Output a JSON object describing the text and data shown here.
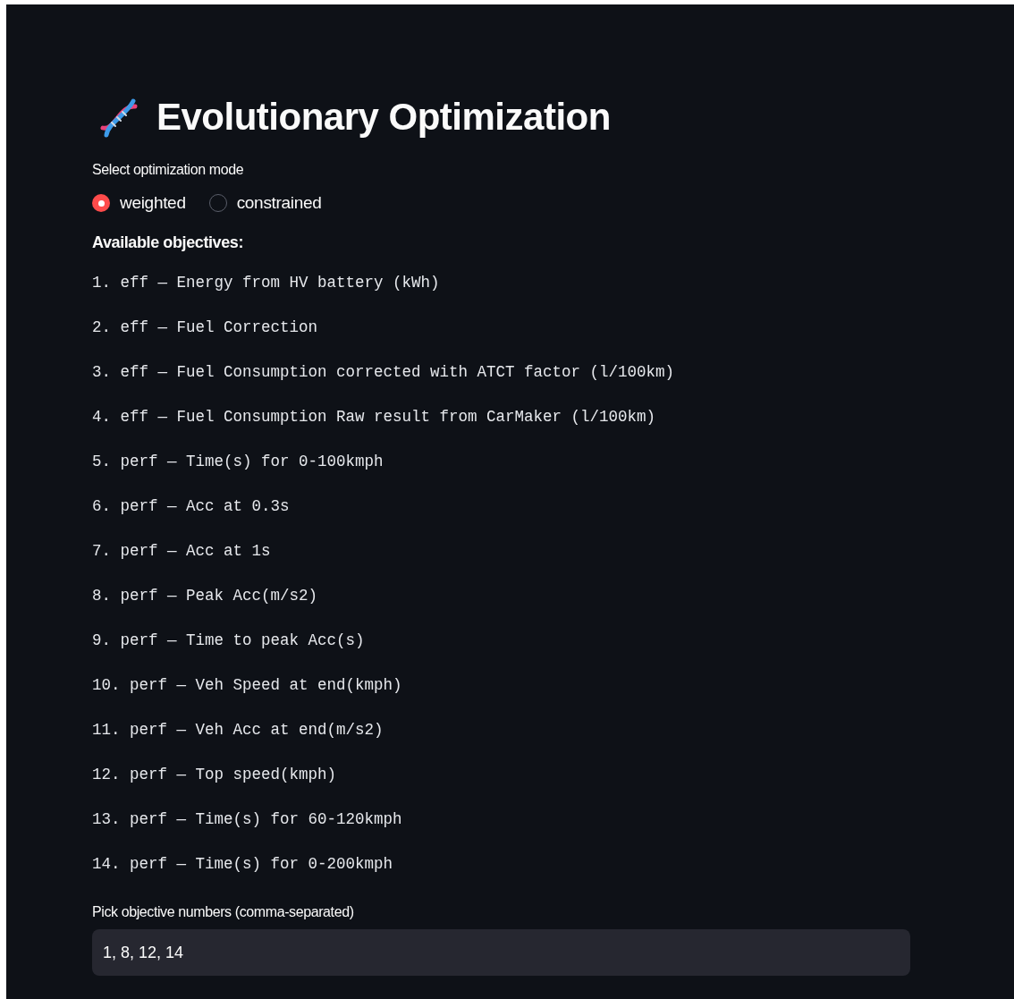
{
  "title": "Evolutionary Optimization",
  "mode": {
    "label": "Select optimization mode",
    "options": [
      {
        "label": "weighted",
        "selected": true
      },
      {
        "label": "constrained",
        "selected": false
      }
    ]
  },
  "objectives_heading": "Available objectives:",
  "objectives": [
    "1. eff — Energy from HV battery (kWh)",
    "2. eff — Fuel Correction",
    "3. eff — Fuel Consumption corrected with ATCT factor (l/100km)",
    "4. eff — Fuel Consumption Raw result from CarMaker (l/100km)",
    "5. perf — Time(s) for 0-100kmph",
    "6. perf — Acc at 0.3s",
    "7. perf — Acc at 1s",
    "8. perf — Peak Acc(m/s2)",
    "9. perf — Time to peak Acc(s)",
    "10. perf — Veh Speed at end(kmph)",
    "11. perf — Veh Acc at end(m/s2)",
    "12. perf — Top speed(kmph)",
    "13. perf — Time(s) for 60-120kmph",
    "14. perf — Time(s) for 0-200kmph"
  ],
  "pick": {
    "label": "Pick objective numbers (comma-separated)",
    "value": "1, 8, 12, 14"
  }
}
